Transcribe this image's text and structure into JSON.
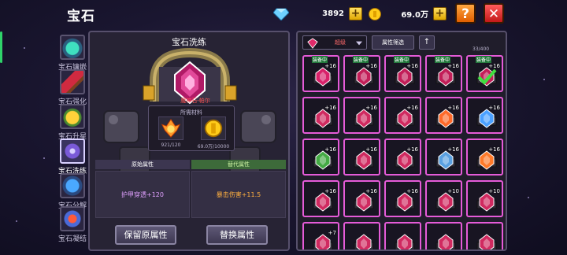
{
  "header": {
    "title": "宝石",
    "diamonds": "3892",
    "gold": "69.0万",
    "help_label": "?",
    "close_label": "✕",
    "plus_label": "+"
  },
  "sidebar": {
    "tabs": [
      {
        "label": "宝石镶嵌",
        "icon": "gem-socket-icon",
        "active": false
      },
      {
        "label": "宝石强化",
        "icon": "gem-enhance-icon",
        "active": false
      },
      {
        "label": "宝石升星",
        "icon": "gem-star-icon",
        "active": false
      },
      {
        "label": "宝石洗练",
        "icon": "gem-refine-icon",
        "active": true
      },
      {
        "label": "宝石分解",
        "icon": "gem-decompose-icon",
        "active": false
      },
      {
        "label": "宝石凝结",
        "icon": "gem-condense-icon",
        "active": false
      }
    ]
  },
  "refine": {
    "title": "宝石洗练",
    "gem_name": "魔神石-帕尔",
    "materials_title": "所需材料",
    "materials": [
      {
        "icon": "fire-essence-icon",
        "count": "921/120"
      },
      {
        "icon": "gold-coin-icon",
        "count": "69.0万/10000"
      }
    ],
    "original_header": "原始属性",
    "replace_header": "替代属性",
    "original_value": "护甲穿透+120",
    "replace_value": "暴击伤害+11.5",
    "keep_button": "保留原属性",
    "swap_button": "替换属性"
  },
  "inventory": {
    "filter_quality": "超级",
    "filter_button": "属性筛选",
    "sort_icon": "↑",
    "count": "33/400",
    "equip_label": "装备中",
    "slots": [
      {
        "equipped": true,
        "level": "+16",
        "color": "#d8216a",
        "check": false
      },
      {
        "equipped": true,
        "level": "+16",
        "color": "#c21e58",
        "check": false
      },
      {
        "equipped": true,
        "level": "+16",
        "color": "#c21e58",
        "check": false
      },
      {
        "equipped": true,
        "level": "+16",
        "color": "#c21e58",
        "check": false
      },
      {
        "equipped": true,
        "level": "+16",
        "color": "#c21e58",
        "check": true
      },
      {
        "equipped": false,
        "level": "+16",
        "color": "#d02a60",
        "check": false
      },
      {
        "equipped": false,
        "level": "+16",
        "color": "#d02a60",
        "check": false
      },
      {
        "equipped": false,
        "level": "+16",
        "color": "#d02a60",
        "check": false
      },
      {
        "equipped": false,
        "level": "+16",
        "color": "#ff6a2a",
        "check": false
      },
      {
        "equipped": false,
        "level": "+16",
        "color": "#4aa0ff",
        "check": false
      },
      {
        "equipped": false,
        "level": "+16",
        "color": "#44aa44",
        "check": false
      },
      {
        "equipped": false,
        "level": "+16",
        "color": "#d02a60",
        "check": false
      },
      {
        "equipped": false,
        "level": "+16",
        "color": "#d02a60",
        "check": false
      },
      {
        "equipped": false,
        "level": "+16",
        "color": "#5aa0e0",
        "check": false
      },
      {
        "equipped": false,
        "level": "+16",
        "color": "#ff7a2a",
        "check": false
      },
      {
        "equipped": false,
        "level": "+16",
        "color": "#d02a60",
        "check": false
      },
      {
        "equipped": false,
        "level": "+16",
        "color": "#d02a60",
        "check": false
      },
      {
        "equipped": false,
        "level": "+16",
        "color": "#d02a60",
        "check": false
      },
      {
        "equipped": false,
        "level": "+10",
        "color": "#d02a60",
        "check": false
      },
      {
        "equipped": false,
        "level": "+10",
        "color": "#d02a60",
        "check": false
      },
      {
        "equipped": false,
        "level": "+7",
        "color": "#d02a60",
        "check": false
      },
      {
        "equipped": false,
        "level": "",
        "color": "#d02a60",
        "check": false
      },
      {
        "equipped": false,
        "level": "",
        "color": "#d02a60",
        "check": false
      },
      {
        "equipped": false,
        "level": "",
        "color": "#d02a60",
        "check": false
      },
      {
        "equipped": false,
        "level": "",
        "color": "#d02a60",
        "check": false
      }
    ]
  }
}
